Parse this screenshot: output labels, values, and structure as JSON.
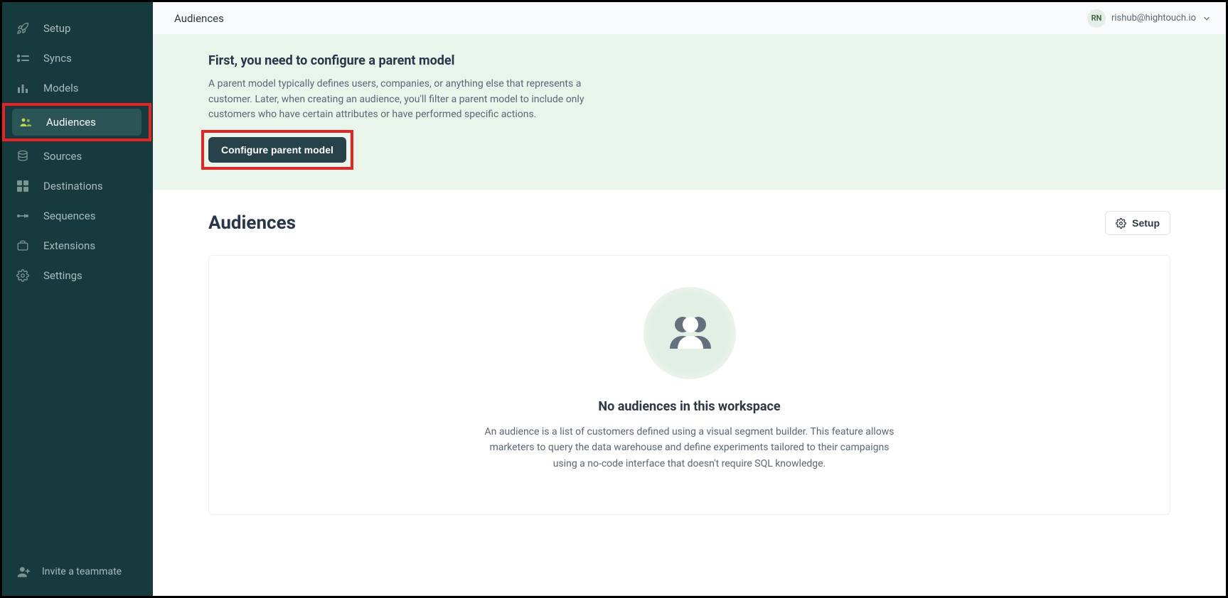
{
  "sidebar": {
    "items": [
      {
        "label": "Setup"
      },
      {
        "label": "Syncs"
      },
      {
        "label": "Models"
      },
      {
        "label": "Audiences"
      },
      {
        "label": "Sources"
      },
      {
        "label": "Destinations"
      },
      {
        "label": "Sequences"
      },
      {
        "label": "Extensions"
      },
      {
        "label": "Settings"
      }
    ],
    "invite_label": "Invite a teammate"
  },
  "topbar": {
    "title": "Audiences",
    "user_initials": "RN",
    "user_email": "rishub@hightouch.io"
  },
  "banner": {
    "title": "First, you need to configure a parent model",
    "description": "A parent model typically defines users, companies, or anything else that represents a customer. Later, when creating an audience, you'll filter a parent model to include only customers who have certain attributes or have performed specific actions.",
    "button_label": "Configure parent model"
  },
  "content": {
    "title": "Audiences",
    "setup_button_label": "Setup",
    "empty_title": "No audiences in this workspace",
    "empty_description": "An audience is a list of customers defined using a visual segment builder. This feature allows marketers to query the data warehouse and define experiments tailored to their campaigns using a no-code interface that doesn't require SQL knowledge."
  }
}
